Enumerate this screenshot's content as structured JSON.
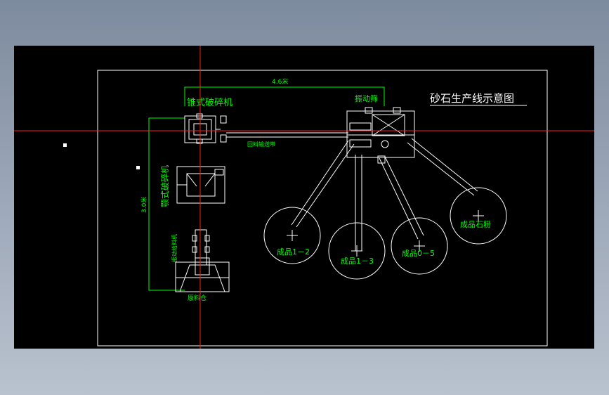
{
  "drawing": {
    "title": "砂石生产线示意图",
    "equipment": {
      "cone_crusher": "锥式破碎机",
      "jaw_crusher": "颚式破碎机",
      "vibrating_screen": "振动筛",
      "vibrating_feeder": "振动给料机",
      "raw_bin": "原料仓",
      "return_conveyor": "回料输送带"
    },
    "dimensions": {
      "width": "4.6米",
      "height": "3.0米"
    },
    "products": {
      "p1": "成品1－2",
      "p2": "成品1－3",
      "p3": "成品0－5",
      "p4": "成品石粉"
    }
  },
  "colors": {
    "background": "#000000",
    "frame": "#ffffff",
    "annotation": "#00ff00",
    "crosshair": "#ff1a1a"
  }
}
